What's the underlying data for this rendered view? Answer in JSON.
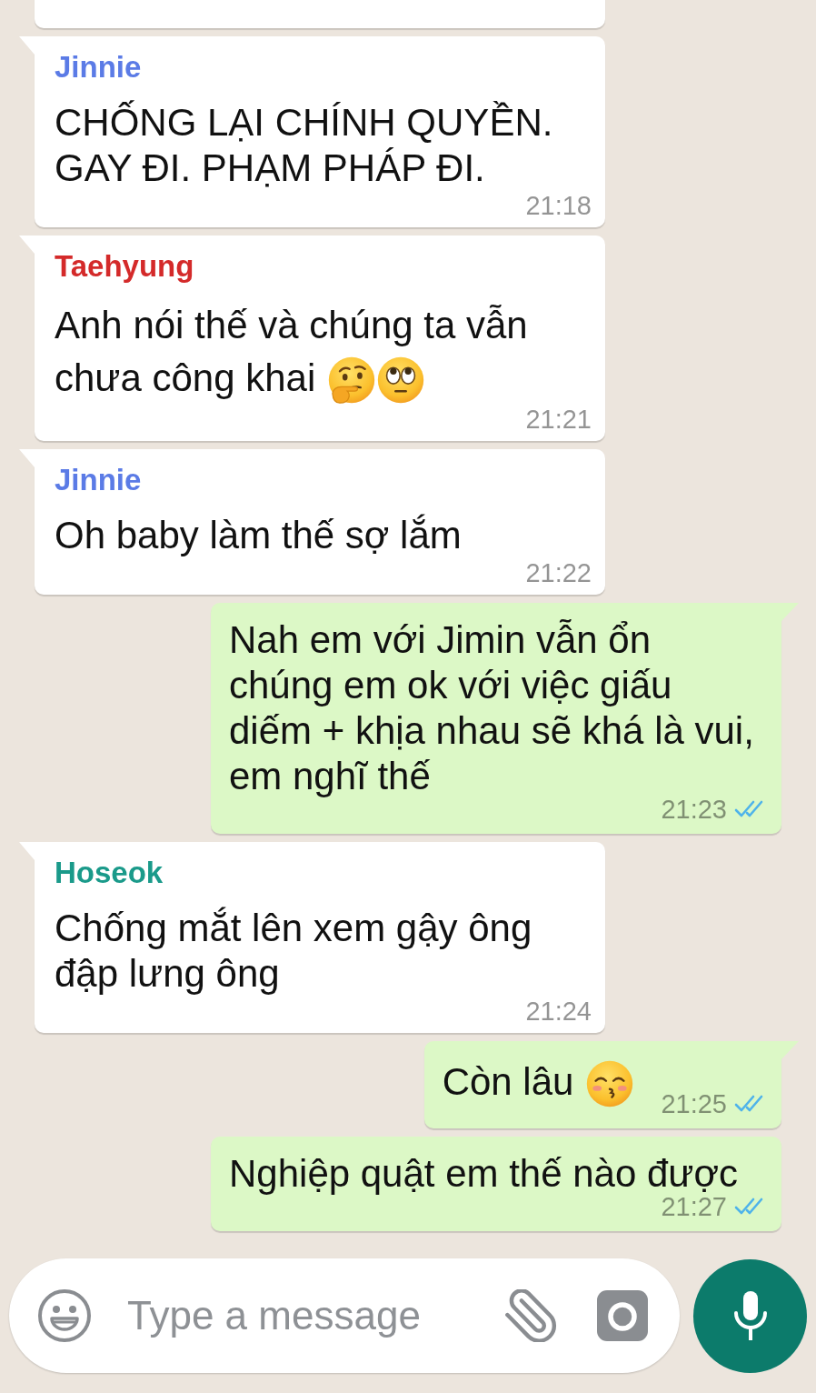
{
  "messages": [
    {
      "kind": "incoming"
    },
    {
      "kind": "incoming",
      "tail": true,
      "sender": {
        "name": "Jinnie",
        "color": "#5b7be6"
      },
      "lines": [
        "CHỐNG LẠI CHÍNH QUYỀN.",
        "GAY ĐI. PHẠM PHÁP ĐI."
      ],
      "time": "21:18"
    },
    {
      "kind": "incoming",
      "tail": true,
      "sender": {
        "name": "Taehyung",
        "color": "#d42a2a"
      },
      "lines": [
        "Anh nói thế và chúng ta vẫn",
        "chưa công khai"
      ],
      "emoji": [
        {
          "kind": "thinking"
        },
        {
          "kind": "eye-roll"
        }
      ],
      "time": "21:21"
    },
    {
      "kind": "incoming",
      "tail": true,
      "sender": {
        "name": "Jinnie",
        "color": "#5b7be6"
      },
      "lines": [
        "Oh baby làm thế sợ lắm"
      ],
      "time": "21:22"
    },
    {
      "kind": "outgoing",
      "tail": true,
      "lines": [
        "Nah em với Jimin vẫn ổn",
        "chúng em ok với việc giấu",
        "diếm + khịa nhau sẽ khá là vui,",
        "em nghĩ thế"
      ],
      "time": "21:23",
      "read": true
    },
    {
      "kind": "incoming",
      "tail": true,
      "sender": {
        "name": "Hoseok",
        "color": "#1a9a8a"
      },
      "lines": [
        "Chống mắt lên xem gậy ông",
        "đập lưng ông"
      ],
      "time": "21:24"
    },
    {
      "kind": "outgoing",
      "tail": true,
      "lines": [
        "Còn lâu"
      ],
      "emoji": [
        {
          "kind": "kissing"
        }
      ],
      "time": "21:25",
      "read": true
    },
    {
      "kind": "outgoing",
      "tail": false,
      "lines": [
        "Nghiệp quật em thế nào được"
      ],
      "time": "21:27",
      "read": true
    }
  ],
  "composer": {
    "placeholder": "Type a message"
  }
}
